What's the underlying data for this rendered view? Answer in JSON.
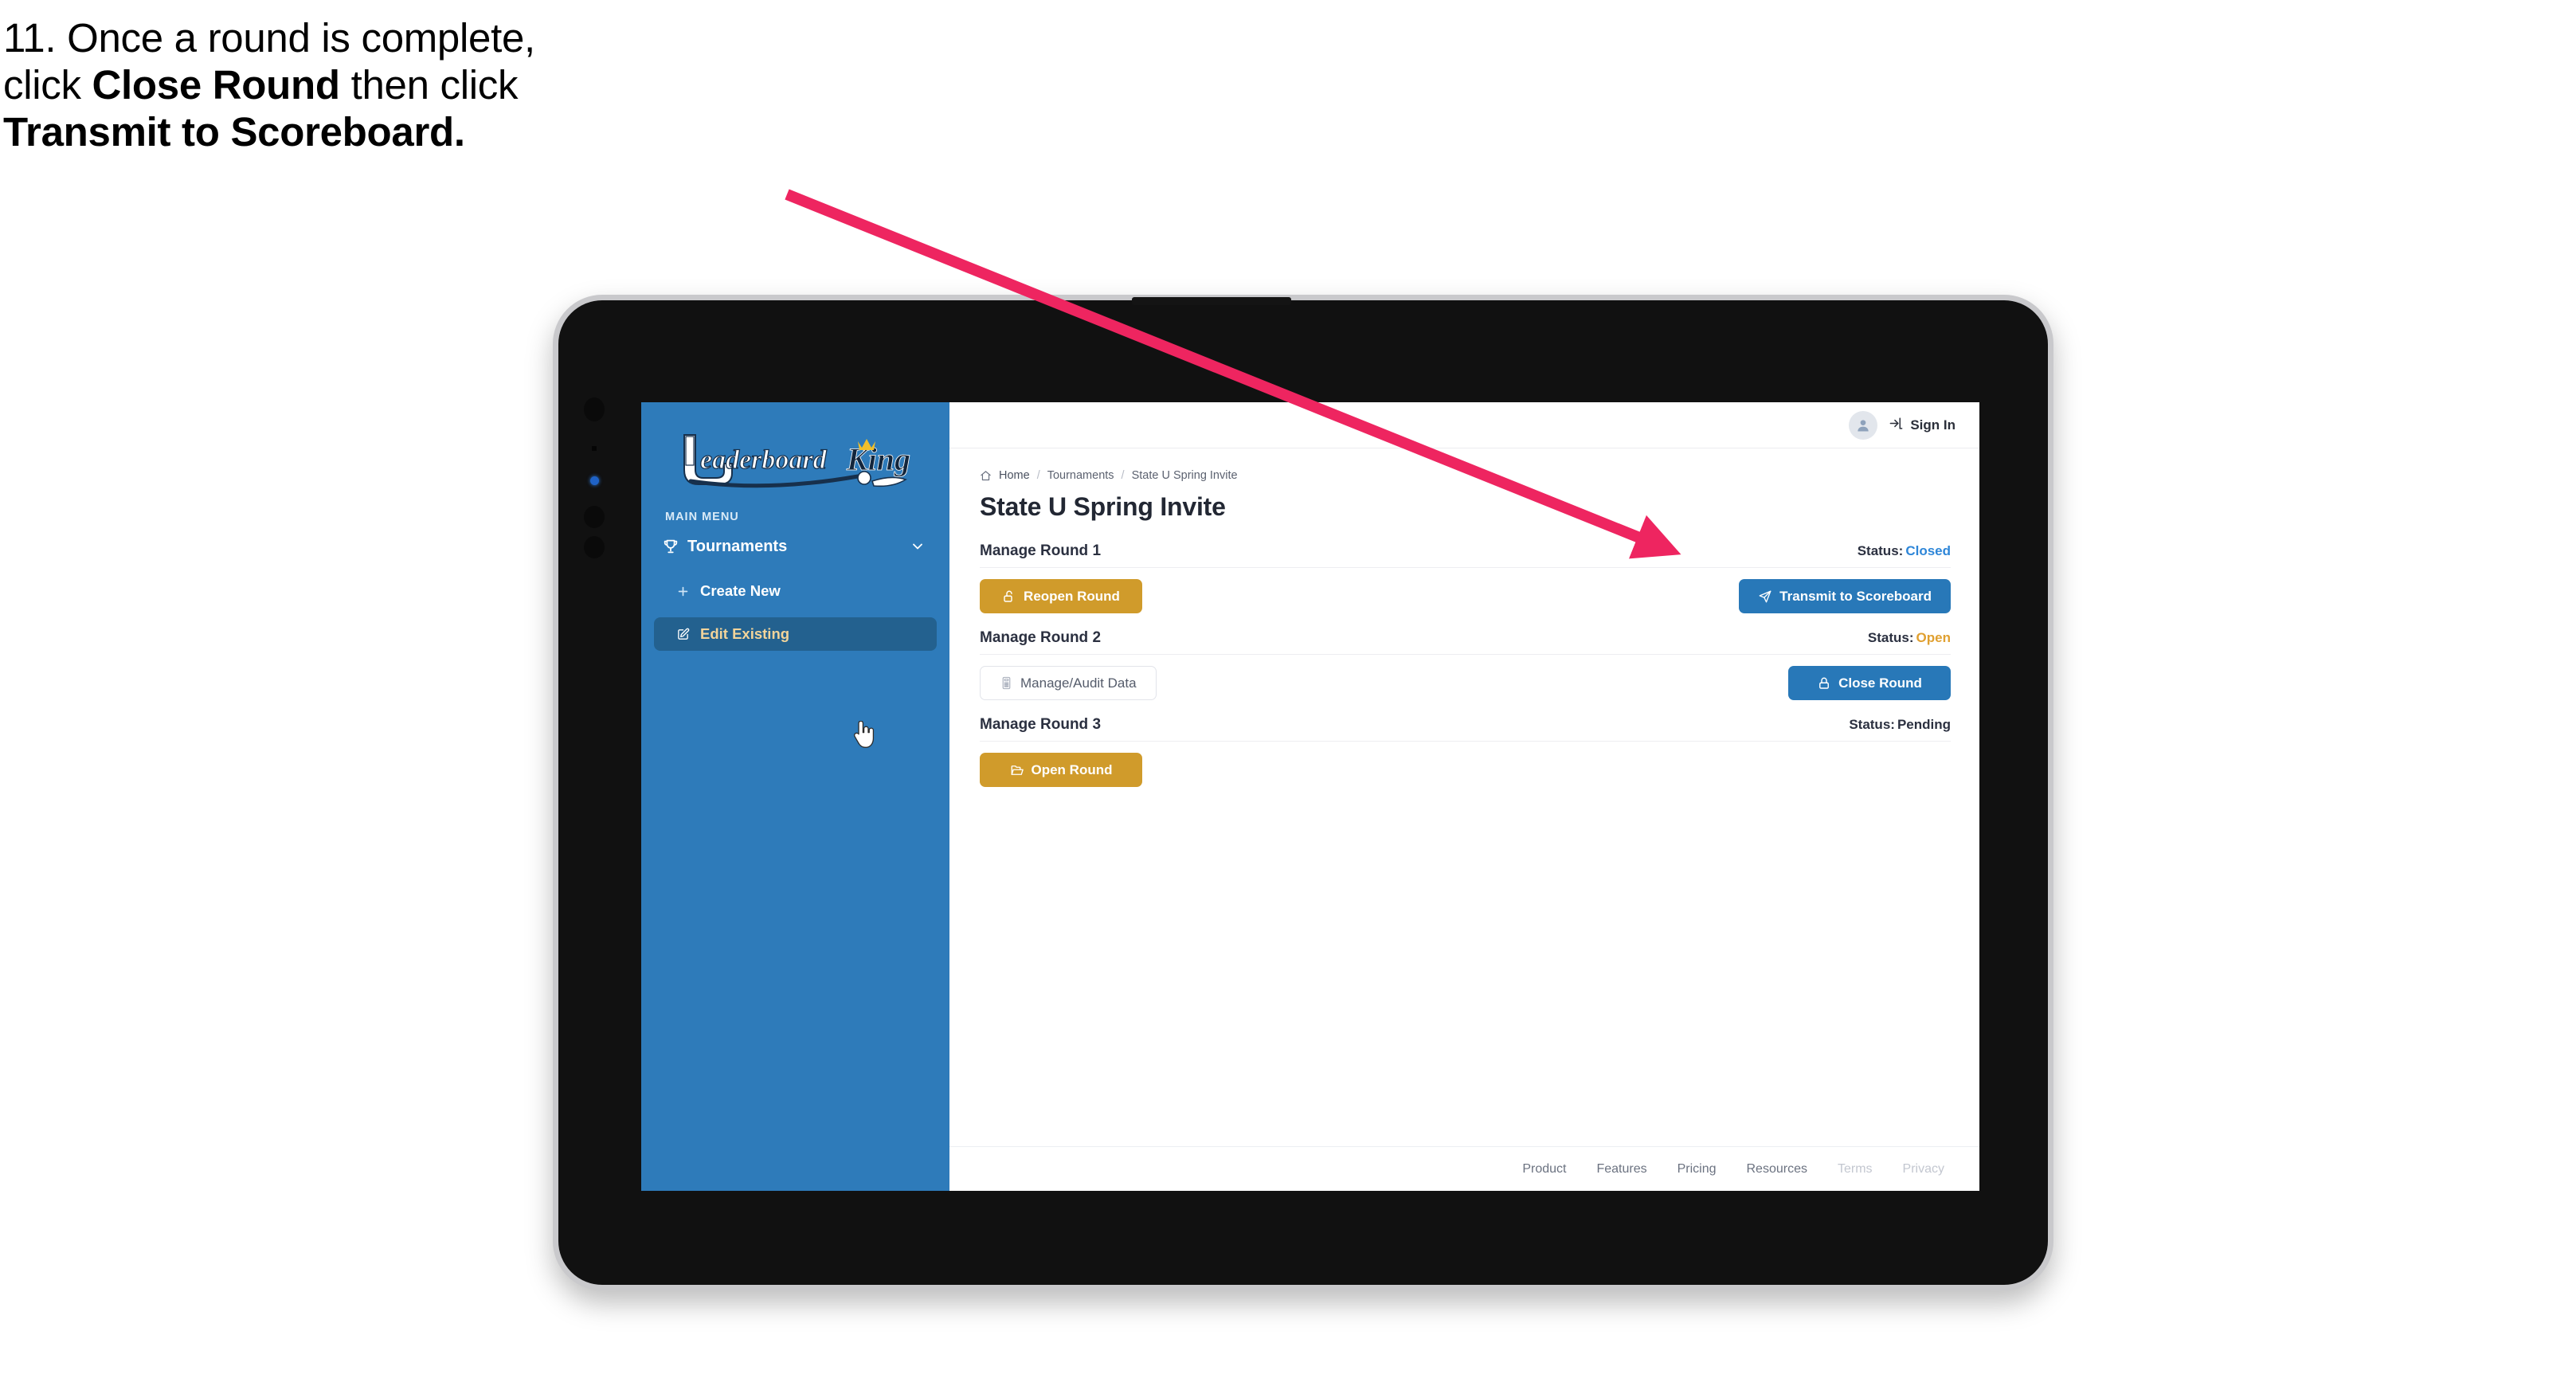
{
  "caption": {
    "line1_plain": "11. Once a round is complete,",
    "line2_pre": "click ",
    "line2_bold": "Close Round",
    "line2_post": " then click",
    "line3_bold": "Transmit to Scoreboard."
  },
  "sidebar": {
    "logo_leaderboard": "Leaderboard",
    "logo_king": "King",
    "menu_label": "MAIN MENU",
    "nav": {
      "tournaments_label": "Tournaments",
      "tournaments_icon": "trophy-icon",
      "chevron_icon": "chevron-down-icon"
    },
    "subitems": [
      {
        "label": "Create New",
        "icon": "plus-icon",
        "active": false
      },
      {
        "label": "Edit Existing",
        "icon": "edit-square-icon",
        "active": true
      }
    ]
  },
  "topbar": {
    "avatar_icon": "user-avatar-icon",
    "signin_icon": "login-arrow-icon",
    "signin_label": "Sign In"
  },
  "breadcrumb": {
    "home_icon": "home-icon",
    "items": [
      "Home",
      "Tournaments",
      "State U Spring Invite"
    ],
    "separator": "/"
  },
  "page": {
    "title": "State U Spring Invite",
    "status_prefix": "Status:"
  },
  "rounds": [
    {
      "name": "Manage Round 1",
      "status_value": "Closed",
      "status_class": "closed",
      "left_button": {
        "label": "Reopen Round",
        "icon": "unlock-icon",
        "style": "gold"
      },
      "right_button": {
        "label": "Transmit to Scoreboard",
        "icon": "paper-plane-icon",
        "style": "blue"
      }
    },
    {
      "name": "Manage Round 2",
      "status_value": "Open",
      "status_class": "open",
      "left_button": {
        "label": "Manage/Audit Data",
        "icon": "calculator-icon",
        "style": "ghost"
      },
      "right_button": {
        "label": "Close Round",
        "icon": "lock-icon",
        "style": "blue"
      }
    },
    {
      "name": "Manage Round 3",
      "status_value": "Pending",
      "status_class": "pending",
      "left_button": {
        "label": "Open Round",
        "icon": "folder-open-icon",
        "style": "gold"
      },
      "right_button": null
    }
  ],
  "footer": {
    "links": [
      {
        "label": "Product",
        "muted": false
      },
      {
        "label": "Features",
        "muted": false
      },
      {
        "label": "Pricing",
        "muted": false
      },
      {
        "label": "Resources",
        "muted": false
      },
      {
        "label": "Terms",
        "muted": true
      },
      {
        "label": "Privacy",
        "muted": true
      }
    ]
  },
  "annotation": {
    "arrow_color": "#ee2560",
    "arrow_target": "transmit-to-scoreboard-button"
  },
  "colors": {
    "sidebar_blue": "#2e7bba",
    "sidebar_active": "#23618f",
    "active_text_gold": "#f2d49a",
    "button_gold": "#d09b2b",
    "button_blue": "#2878b8",
    "status_closed": "#2e86d8",
    "status_open": "#e0a030",
    "arrow_pink": "#ee2560",
    "bezel_black": "#111111",
    "bezel_silver": "#c9c9cc"
  },
  "cursor": {
    "icon": "hand-pointer-cursor"
  }
}
